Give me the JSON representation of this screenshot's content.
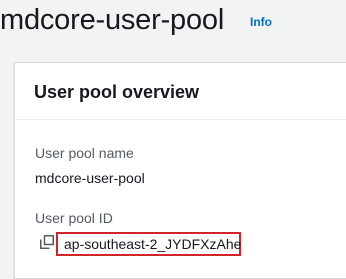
{
  "header": {
    "title": "mdcore-user-pool",
    "info_label": "Info"
  },
  "overview": {
    "title": "User pool overview",
    "fields": [
      {
        "label": "User pool name",
        "value": "mdcore-user-pool"
      },
      {
        "label": "User pool ID",
        "value": "ap-southeast-2_JYDFXzAhe"
      }
    ],
    "copy_icon": "copy-icon"
  },
  "colors": {
    "accent_link": "#0073bb",
    "highlight_border": "#d3232b",
    "background": "#f2f3f3"
  }
}
